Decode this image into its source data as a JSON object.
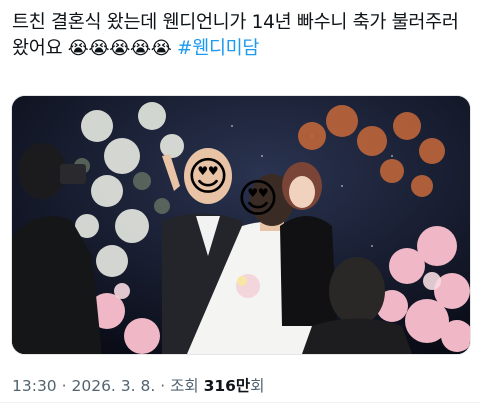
{
  "tweet": {
    "text_line1": "트친 결혼식 왔는데 웬디언니가 14년 빠수니 축가 불러주러",
    "text_line2_prefix": "왔어요",
    "emojis": [
      "😭",
      "😭",
      "😭",
      "😭",
      "😭"
    ],
    "hashtag": "#웬디미담"
  },
  "photo": {
    "face_sticker_left": "😍",
    "face_sticker_right": "😍",
    "colors": {
      "backdrop": "#0c1020",
      "flowers_white": "#eef0ea",
      "flowers_pink": "#f0b8c6",
      "foliage_orange": "#c86a3a",
      "gown": "#f4f4f2",
      "suit": "#23252b"
    }
  },
  "meta": {
    "time": "13:30",
    "separator": "·",
    "date": "2026. 3. 8.",
    "views_label": "조회",
    "views_count": "316만",
    "views_unit": "회"
  }
}
